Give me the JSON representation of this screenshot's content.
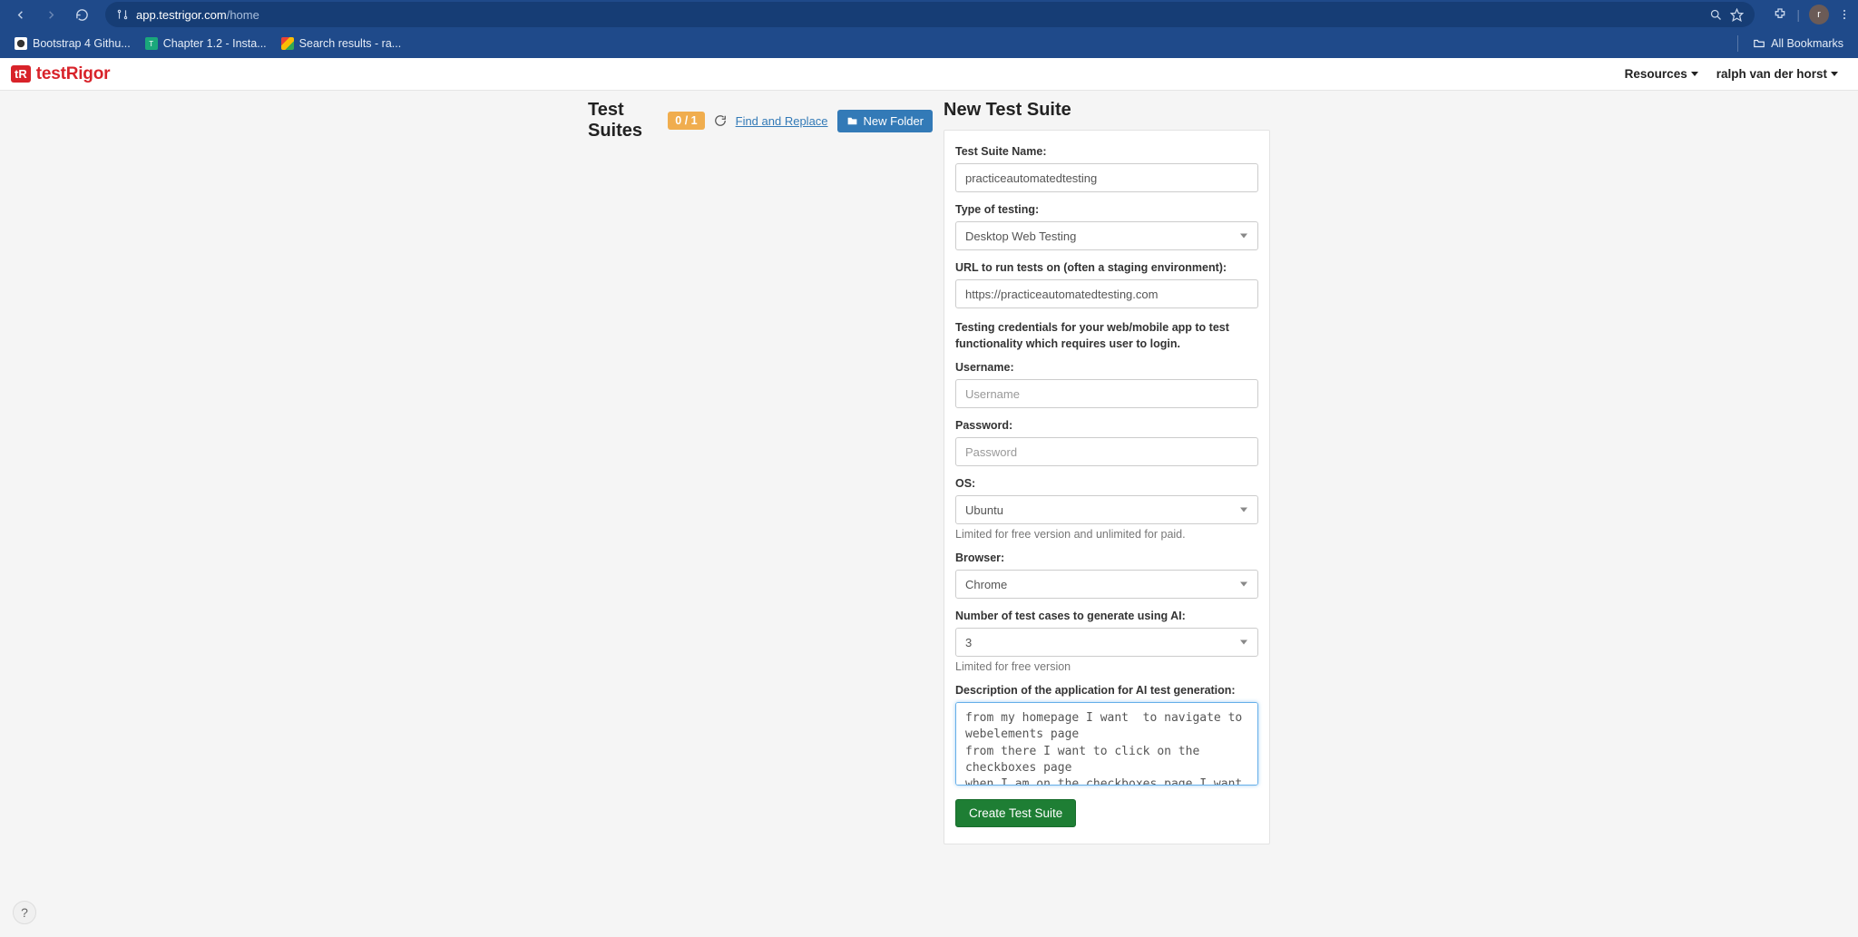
{
  "browser": {
    "url_host": "app.testrigor.com",
    "url_path": "/home",
    "avatar_letter": "r",
    "bookmarks": [
      {
        "label": "Bootstrap 4 Githu...",
        "fav": "white"
      },
      {
        "label": "Chapter 1.2 - Insta...",
        "fav": "green"
      },
      {
        "label": "Search results - ra...",
        "fav": "gmail"
      }
    ],
    "all_bookmarks": "All Bookmarks"
  },
  "header": {
    "logo_badge": "tR",
    "logo_text": "testRigor",
    "resources": "Resources",
    "user": "ralph van der horst"
  },
  "testSuites": {
    "title": "Test Suites",
    "count": "0 / 1",
    "findReplace": "Find and Replace",
    "newFolder": "New Folder"
  },
  "form": {
    "title": "New Test Suite",
    "name_label": "Test Suite Name:",
    "name_value": "practiceautomatedtesting",
    "type_label": "Type of testing:",
    "type_value": "Desktop Web Testing",
    "url_label": "URL to run tests on (often a staging environment):",
    "url_value": "https://practiceautomatedtesting.com",
    "creds_help": "Testing credentials for your web/mobile app to test functionality which requires user to login.",
    "username_label": "Username:",
    "username_placeholder": "Username",
    "password_label": "Password:",
    "password_placeholder": "Password",
    "os_label": "OS:",
    "os_value": "Ubuntu",
    "os_help": "Limited for free version and unlimited for paid.",
    "browser_label": "Browser:",
    "browser_value": "Chrome",
    "numcases_label": "Number of test cases to generate using AI:",
    "numcases_value": "3",
    "numcases_help": "Limited for free version",
    "desc_label": "Description of the application for AI test generation:",
    "desc_value": "from my homepage I want  to navigate to webelements page\nfrom there I want to click on the checkboxes page\nwhen I am on the checkboxes page I want to test the checkboxes if get a happy or unhappy smiley back",
    "submit": "Create Test Suite"
  }
}
